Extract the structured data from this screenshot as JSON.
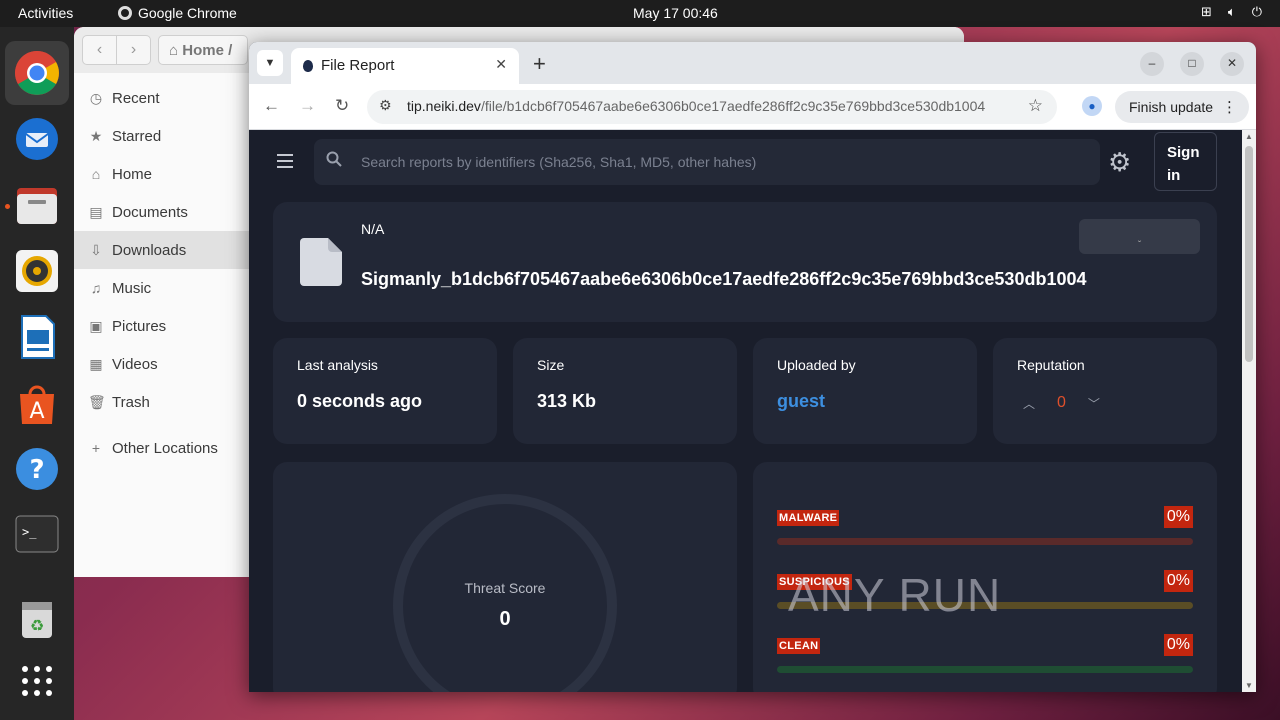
{
  "topbar": {
    "activities": "Activities",
    "app_name": "Google Chrome",
    "clock": "May 17  00:46"
  },
  "dock": {
    "items": [
      "chrome-icon",
      "thunderbird-icon",
      "files-icon",
      "rhythmbox-icon",
      "writer-icon",
      "app-center-icon",
      "help-icon",
      "terminal-icon",
      "trash-icon",
      "app-grid-icon"
    ]
  },
  "files": {
    "path_label": "Home",
    "sidebar": [
      {
        "label": "Recent",
        "icon": "clock-icon"
      },
      {
        "label": "Starred",
        "icon": "star-icon"
      },
      {
        "label": "Home",
        "icon": "home-icon"
      },
      {
        "label": "Documents",
        "icon": "document-icon"
      },
      {
        "label": "Downloads",
        "icon": "download-icon"
      },
      {
        "label": "Music",
        "icon": "music-icon"
      },
      {
        "label": "Pictures",
        "icon": "picture-icon"
      },
      {
        "label": "Videos",
        "icon": "video-icon"
      },
      {
        "label": "Trash",
        "icon": "trash-icon"
      }
    ],
    "other_locations": "Other Locations"
  },
  "chrome": {
    "tab_title": "File Report",
    "url_host": "tip.neiki.dev",
    "url_path": "/file/b1dcb6f705467aabe6e6306b0ce17aedfe286ff2c9c35e769bbd3ce530db1004",
    "update_label": "Finish update"
  },
  "page": {
    "search_placeholder": "Search reports by identifiers (Sha256, Sha1, MD5, other hahes)",
    "signin_label": "Sign in",
    "file": {
      "type": "N/A",
      "name": "Sigmanly_b1dcb6f705467aabe6e6306b0ce17aedfe286ff2c9c35e769bbd3ce530db1004"
    },
    "stats": {
      "last_analysis_label": "Last analysis",
      "last_analysis_value": "0 seconds ago",
      "size_label": "Size",
      "size_value": "313 Kb",
      "uploaded_label": "Uploaded by",
      "uploaded_value": "guest",
      "reputation_label": "Reputation",
      "reputation_value": "0"
    },
    "threat": {
      "label": "Threat Score",
      "value": "0"
    },
    "verdicts": [
      {
        "label": "MALWARE",
        "percent": "0%",
        "bar_color": "#5a2a2a"
      },
      {
        "label": "SUSPICIOUS",
        "percent": "0%",
        "bar_color": "#5a4d25"
      },
      {
        "label": "CLEAN",
        "percent": "0%",
        "bar_color": "#1f4d33"
      }
    ],
    "watermark": "ANY RUN"
  }
}
